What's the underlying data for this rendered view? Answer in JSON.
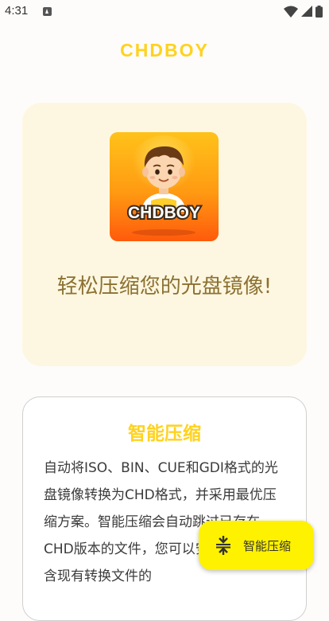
{
  "status_bar": {
    "time": "4:31",
    "notification_icon": "a-box-icon",
    "wifi_icon": "wifi-icon",
    "signal_icon": "cell-signal-icon",
    "battery_icon": "battery-icon"
  },
  "header": {
    "title": "CHDBOY"
  },
  "hero": {
    "logo_text": "CHDBOY",
    "tagline": "轻松压缩您的光盘镜像!"
  },
  "feature": {
    "title": "智能压缩",
    "description": "自动将ISO、BIN、CUE和GDI格式的光盘镜像转换为CHD格式，并采用最优压缩方案。智能压缩会自动跳过已存在CHD版本的文件，您可以安全地使用包含现有转换文件的"
  },
  "fab": {
    "label": "智能压缩",
    "icon": "compress-icon"
  },
  "colors": {
    "accent": "#ffd21f",
    "fab": "#fff200",
    "hero_bg": "#fdf7e1",
    "hero_text": "#8c7132"
  }
}
